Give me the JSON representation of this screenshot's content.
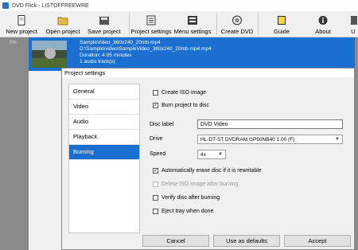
{
  "window": {
    "title": "DVD Flick - LISTOFFREEWRE"
  },
  "toolbar": {
    "new_project": "New project",
    "open_project": "Open project",
    "save_project": "Save project",
    "project_settings": "Project settings",
    "menu_settings": "Menu settings",
    "create_dvd": "Create DVD",
    "guide": "Guide",
    "about": "About",
    "cut": "U"
  },
  "progress": {
    "label": "0%"
  },
  "project_item": {
    "name": "SampleVideo_360x240_20mb-mp4",
    "path": "D:\\Sample\\video\\SampleVideo_360x240_20mb-mp4.mp4",
    "duration": "Duration: 4:05 minutes",
    "audio": "1 audio track(s)"
  },
  "dialog": {
    "title": "Project settings",
    "nav": [
      "General",
      "Video",
      "Audio",
      "Playback",
      "Burning"
    ],
    "active_nav": "Burning",
    "create_iso": {
      "label": "Create ISO image",
      "checked": false
    },
    "burn_to_disc": {
      "label": "Burn project to disc",
      "checked": true
    },
    "disc_label": {
      "label": "Disc label",
      "value": "DVD Video"
    },
    "drive": {
      "label": "Drive",
      "value": "HL-DT-ST DVDRAM GP50NB40 1.00 (F)"
    },
    "speed": {
      "label": "Speed",
      "value": "4x"
    },
    "auto_erase": {
      "label": "Automatically erase disc if it is rewritable",
      "checked": true
    },
    "delete_iso": {
      "label": "Delete ISO image after burning",
      "checked": false,
      "disabled": true
    },
    "verify": {
      "label": "Verify disc after burning",
      "checked": false
    },
    "eject": {
      "label": "Eject tray when done",
      "checked": false
    },
    "buttons": {
      "cancel": "Cancel",
      "use_defaults": "Use as defaults",
      "accept": "Accept"
    }
  },
  "colors": {
    "accent": "#1a6fd0",
    "strip": "#8a8a8a"
  }
}
